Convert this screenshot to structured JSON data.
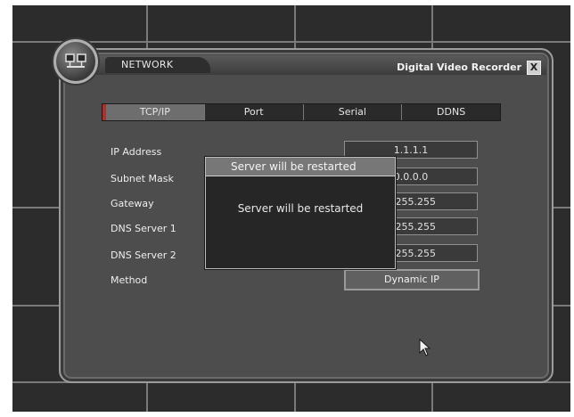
{
  "window": {
    "section_title": "NETWORK",
    "app_title": "Digital Video Recorder",
    "close_glyph": "X"
  },
  "tabs": [
    {
      "label": "TCP/IP",
      "active": true
    },
    {
      "label": "Port",
      "active": false
    },
    {
      "label": "Serial",
      "active": false
    },
    {
      "label": "DDNS",
      "active": false
    }
  ],
  "fields": {
    "ip_address": {
      "label": "IP Address",
      "value": "1.1.1.1"
    },
    "subnet_mask": {
      "label": "Subnet Mask",
      "value": "0.0.0.0"
    },
    "gateway": {
      "label": "Gateway",
      "value": "5.255.255"
    },
    "dns_server_1": {
      "label": "DNS Server 1",
      "value": "5.255.255"
    },
    "dns_server_2": {
      "label": "DNS Server 2",
      "value": "5.255.255"
    },
    "method": {
      "label": "Method",
      "value": "Dynamic IP"
    }
  },
  "dialog": {
    "title": "Server will be restarted",
    "message": "Server will be restarted"
  },
  "colors": {
    "background": "#2c2c2c",
    "panel": "#4d4d4d",
    "active_tab_marker": "#b03030"
  },
  "icons": {
    "logo": "network-logo-icon",
    "cursor": "mouse-pointer-icon"
  }
}
